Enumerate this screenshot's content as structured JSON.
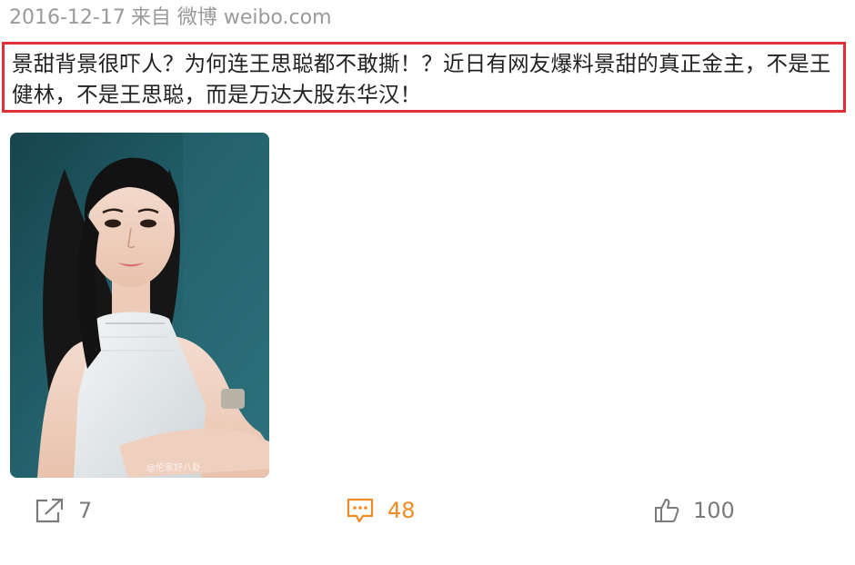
{
  "post": {
    "date": "2016-12-17",
    "source": "来自 微博 weibo.com",
    "text": "景甜背景很吓人？为何连王思聪都不敢撕！？近日有网友爆料景甜的真正金主，不是王健林，不是王思聪，而是万达大股东华汉！",
    "image_watermark": "@伦家好八卦"
  },
  "actions": {
    "repost": {
      "icon": "repost-icon",
      "count": "7"
    },
    "comment": {
      "icon": "comment-icon",
      "count": "48"
    },
    "like": {
      "icon": "thumbs-up-icon",
      "count": "100"
    }
  },
  "colors": {
    "highlight_border": "#e0313b",
    "meta_text": "#9a9a9a",
    "comment_accent": "#f08a24",
    "photo_background": "#1f5a62"
  }
}
